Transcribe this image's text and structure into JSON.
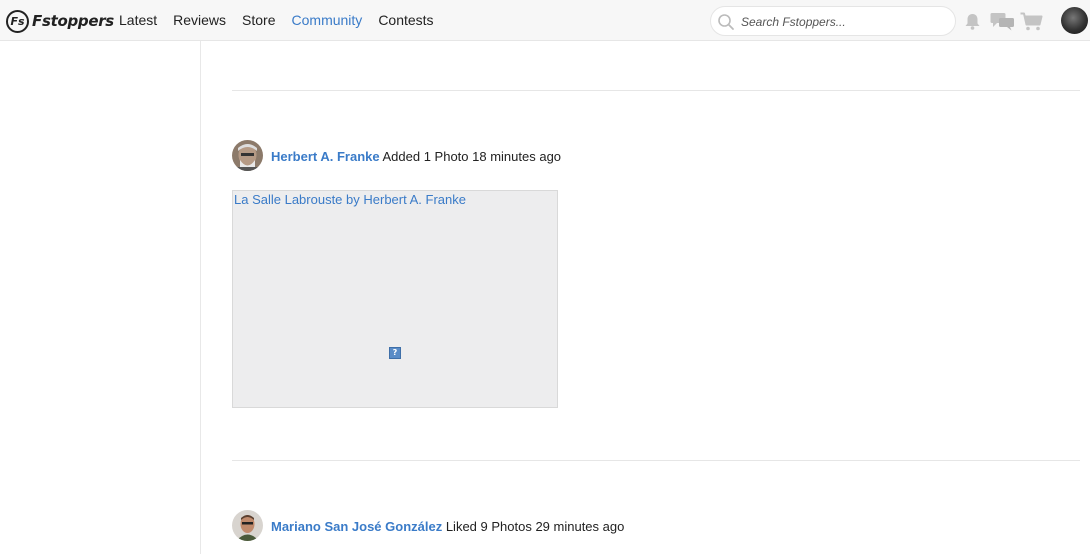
{
  "brand": {
    "logo_mark": "Fs",
    "name": "Fstoppers"
  },
  "nav": {
    "items": [
      {
        "label": "Latest",
        "active": false
      },
      {
        "label": "Reviews",
        "active": false
      },
      {
        "label": "Store",
        "active": false
      },
      {
        "label": "Community",
        "active": true
      },
      {
        "label": "Contests",
        "active": false
      }
    ]
  },
  "search": {
    "placeholder": "Search Fstoppers..."
  },
  "header_icons": [
    "bell-icon",
    "messages-icon",
    "cart-icon"
  ],
  "feed": [
    {
      "user": "Herbert A. Franke",
      "action": " Added 1 Photo 18 minutes ago",
      "photo_alt": "La Salle Labrouste by Herbert A. Franke"
    },
    {
      "user": "Mariano San José González",
      "action": " Liked 9 Photos 29 minutes ago"
    }
  ],
  "colors": {
    "accent": "#3a7bc8",
    "nav_bg": "#f7f7f7",
    "divider": "#e6e6e6"
  }
}
